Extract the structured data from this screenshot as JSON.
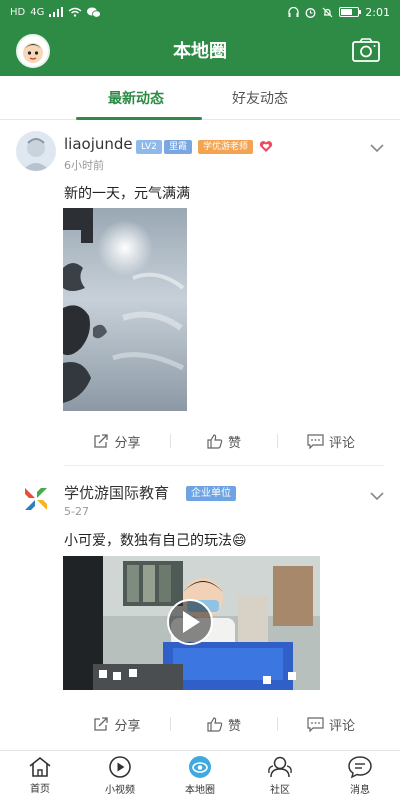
{
  "status_bar": {
    "left_icons": [
      "HD",
      "4G"
    ],
    "time": "2:01",
    "battery_level": 0.7
  },
  "header": {
    "title": "本地圈"
  },
  "tabs": [
    {
      "label": "最新动态",
      "active": true
    },
    {
      "label": "好友动态",
      "active": false
    }
  ],
  "posts": [
    {
      "user": "liaojunde",
      "badges": [
        "LV2",
        "里霞",
        "学优游老师"
      ],
      "time": "6小时前",
      "text": "新的一天，元气满满",
      "media": "sky-photo",
      "actions": [
        "分享",
        "赞",
        "评论"
      ]
    },
    {
      "user": "学优游国际教育",
      "badges": [
        "企业单位"
      ],
      "time": "5-27",
      "text": "小可爱，数独有自己的玩法😄",
      "media": "video",
      "actions": [
        "分享",
        "赞",
        "评论"
      ]
    }
  ],
  "bottom_nav": [
    {
      "label": "首页",
      "icon": "home-icon"
    },
    {
      "label": "小视频",
      "icon": "play-icon"
    },
    {
      "label": "本地圈",
      "icon": "eye-icon",
      "active": true
    },
    {
      "label": "社区",
      "icon": "community-icon"
    },
    {
      "label": "消息",
      "icon": "message-icon"
    }
  ],
  "colors": {
    "primary": "#2e8b45",
    "badge_blue": "#7fb2ea",
    "badge_orange": "#f3a452"
  }
}
